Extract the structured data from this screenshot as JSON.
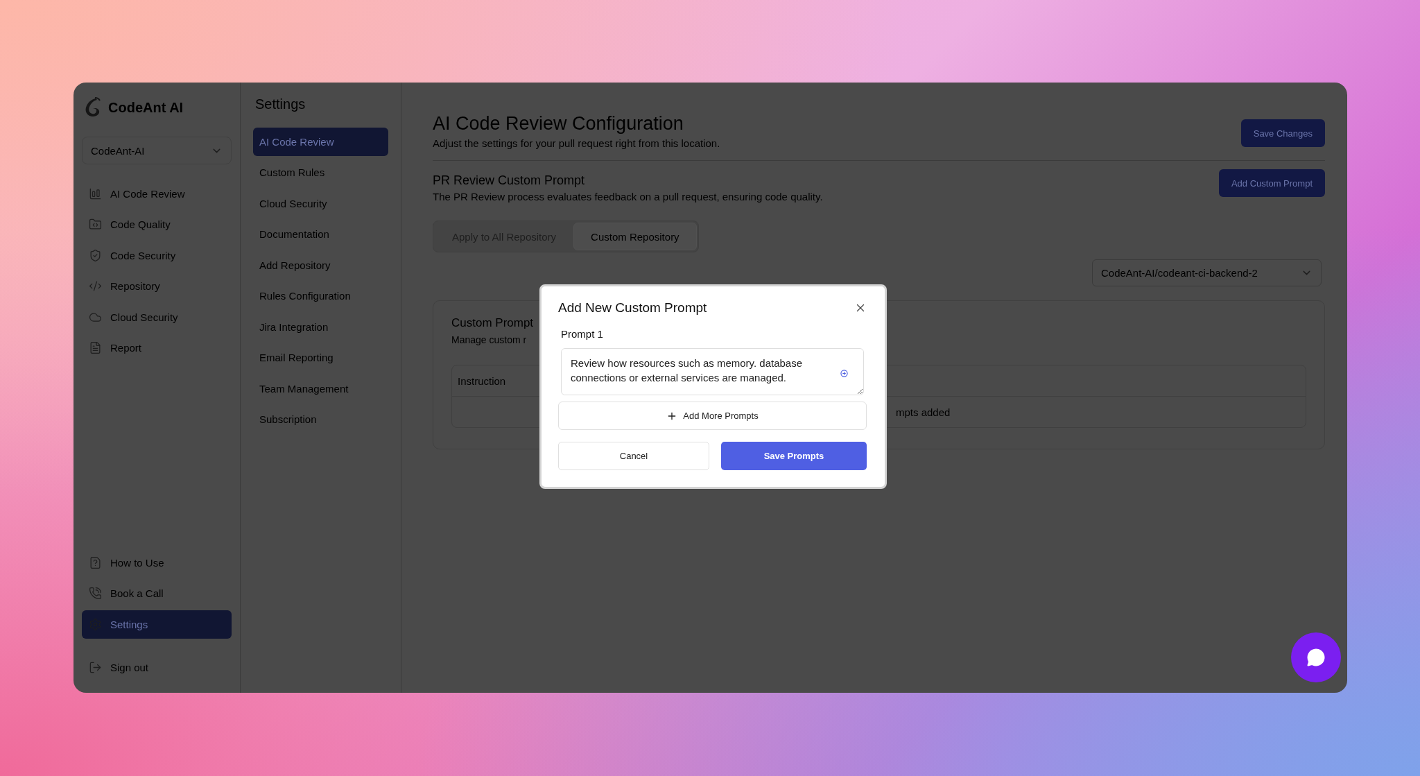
{
  "sidebar": {
    "brand": "CodeAnt AI",
    "org_select": {
      "value": "CodeAnt-AI"
    },
    "items": [
      {
        "label": "AI Code Review",
        "selected": false
      },
      {
        "label": "Code Quality",
        "selected": false
      },
      {
        "label": "Code Security",
        "selected": false
      },
      {
        "label": "Repository",
        "selected": false
      },
      {
        "label": "Cloud Security",
        "selected": false
      },
      {
        "label": "Report",
        "selected": false
      }
    ],
    "bottom_items": [
      {
        "label": "How to Use",
        "selected": false
      },
      {
        "label": "Book a Call",
        "selected": false
      },
      {
        "label": "Settings",
        "selected": true
      }
    ],
    "sign_out": "Sign out"
  },
  "settings_nav": {
    "title": "Settings",
    "items": [
      {
        "label": "AI Code Review",
        "selected": true
      },
      {
        "label": "Custom Rules",
        "selected": false
      },
      {
        "label": "Cloud Security",
        "selected": false
      },
      {
        "label": "Documentation",
        "selected": false
      },
      {
        "label": "Add Repository",
        "selected": false
      },
      {
        "label": "Rules Configuration",
        "selected": false
      },
      {
        "label": "Jira Integration",
        "selected": false
      },
      {
        "label": "Email Reporting",
        "selected": false
      },
      {
        "label": "Team Management",
        "selected": false
      },
      {
        "label": "Subscription",
        "selected": false
      }
    ]
  },
  "main": {
    "title": "AI Code Review Configuration",
    "subtitle": "Adjust the settings for your pull request right from this location.",
    "save_button": "Save Changes",
    "section": {
      "title": "PR Review Custom Prompt",
      "description": "The PR Review process evaluates feedback on a pull request, ensuring code quality.",
      "add_button": "Add Custom Prompt"
    },
    "tabs": [
      {
        "label": "Apply to All Repository",
        "selected": false
      },
      {
        "label": "Custom Repository",
        "selected": true
      }
    ],
    "repo_select": {
      "value": "CodeAnt-AI/codeant-ci-backend-2"
    },
    "card": {
      "title": "Custom Prompt",
      "description": "Manage custom r",
      "table": {
        "columns": [
          "Instruction"
        ],
        "empty_text": "mpts added"
      }
    }
  },
  "modal": {
    "title": "Add New Custom Prompt",
    "field": {
      "label": "Prompt 1",
      "value": "Review how resources such as memory. database connections or external services are managed."
    },
    "add_more": "Add More Prompts",
    "buttons": [
      {
        "label": "Cancel",
        "kind": "secondary"
      },
      {
        "label": "Save Prompts",
        "kind": "primary"
      }
    ]
  }
}
